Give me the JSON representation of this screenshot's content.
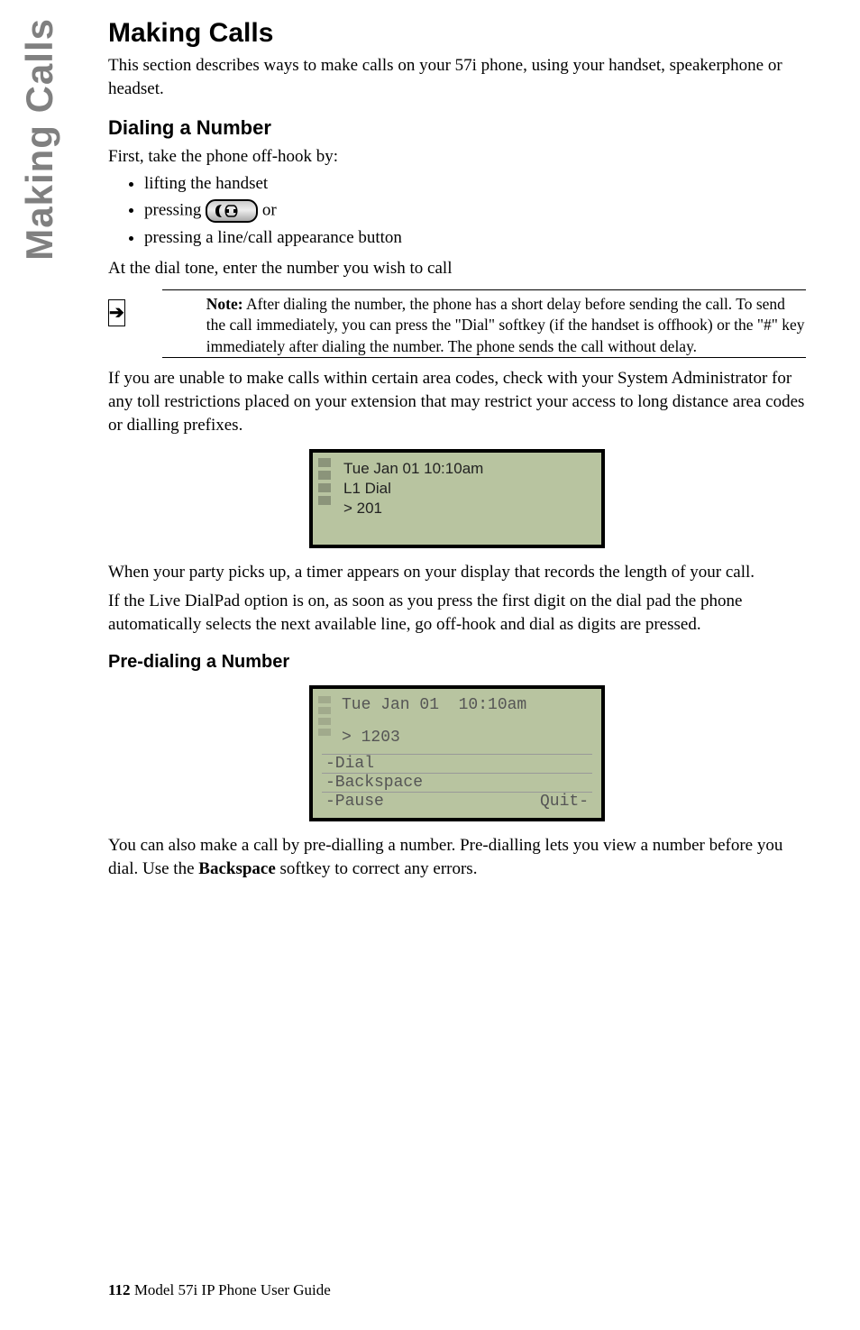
{
  "sideTab": "Making Calls",
  "h1": "Making Calls",
  "intro": "This section describes ways to make calls on your 57i phone, using your handset, speakerphone or headset.",
  "h2_dialing": "Dialing a Number",
  "dial_lead": "First, take the phone off-hook by:",
  "bullets": {
    "b1": "lifting the handset",
    "b2_pre": "pressing ",
    "b2_post": " or",
    "b3": "pressing a line/call appearance button"
  },
  "dial_after_list": "At the dial tone, enter the number you wish to call",
  "note": {
    "label": "Note:",
    "text": " After dialing the number, the phone has a short delay before sending the call. To send the call immediately, you can press the \"Dial\" softkey (if the handset is offhook) or the \"#\" key immediately after dialing the number. The phone sends the call without delay."
  },
  "para_restrict": "If you are unable to make calls within certain area codes, check with your System Administrator for any toll restrictions placed on your extension that may restrict your access to long distance area codes or dialling prefixes.",
  "screen1": {
    "time": "Tue Jan 01  10:10am",
    "line1": "L1 Dial",
    "line2": "> 201"
  },
  "para_timer": "When your party picks up, a timer appears on your display that records the length of your call.",
  "para_livedial": "If the Live DialPad option is on, as soon as you press the first digit on the dial pad the phone automatically selects the next available line, go off-hook and dial as digits are pressed.",
  "h3_predial": "Pre-dialing a Number",
  "screen2": {
    "time": "Tue Jan 01  10:10am",
    "entry": "> 1203",
    "sk1": "-Dial",
    "sk2": "-Backspace",
    "sk3": "-Pause",
    "sk_quit": "Quit-"
  },
  "para_predial": "You can also make a call by pre-dialling a number. Pre-dialling lets you view a number before you dial. Use the ",
  "para_predial_bold": "Backspace",
  "para_predial_after": " softkey to correct any errors.",
  "footer": {
    "page": "112",
    "title": "  Model 57i IP Phone User Guide"
  }
}
